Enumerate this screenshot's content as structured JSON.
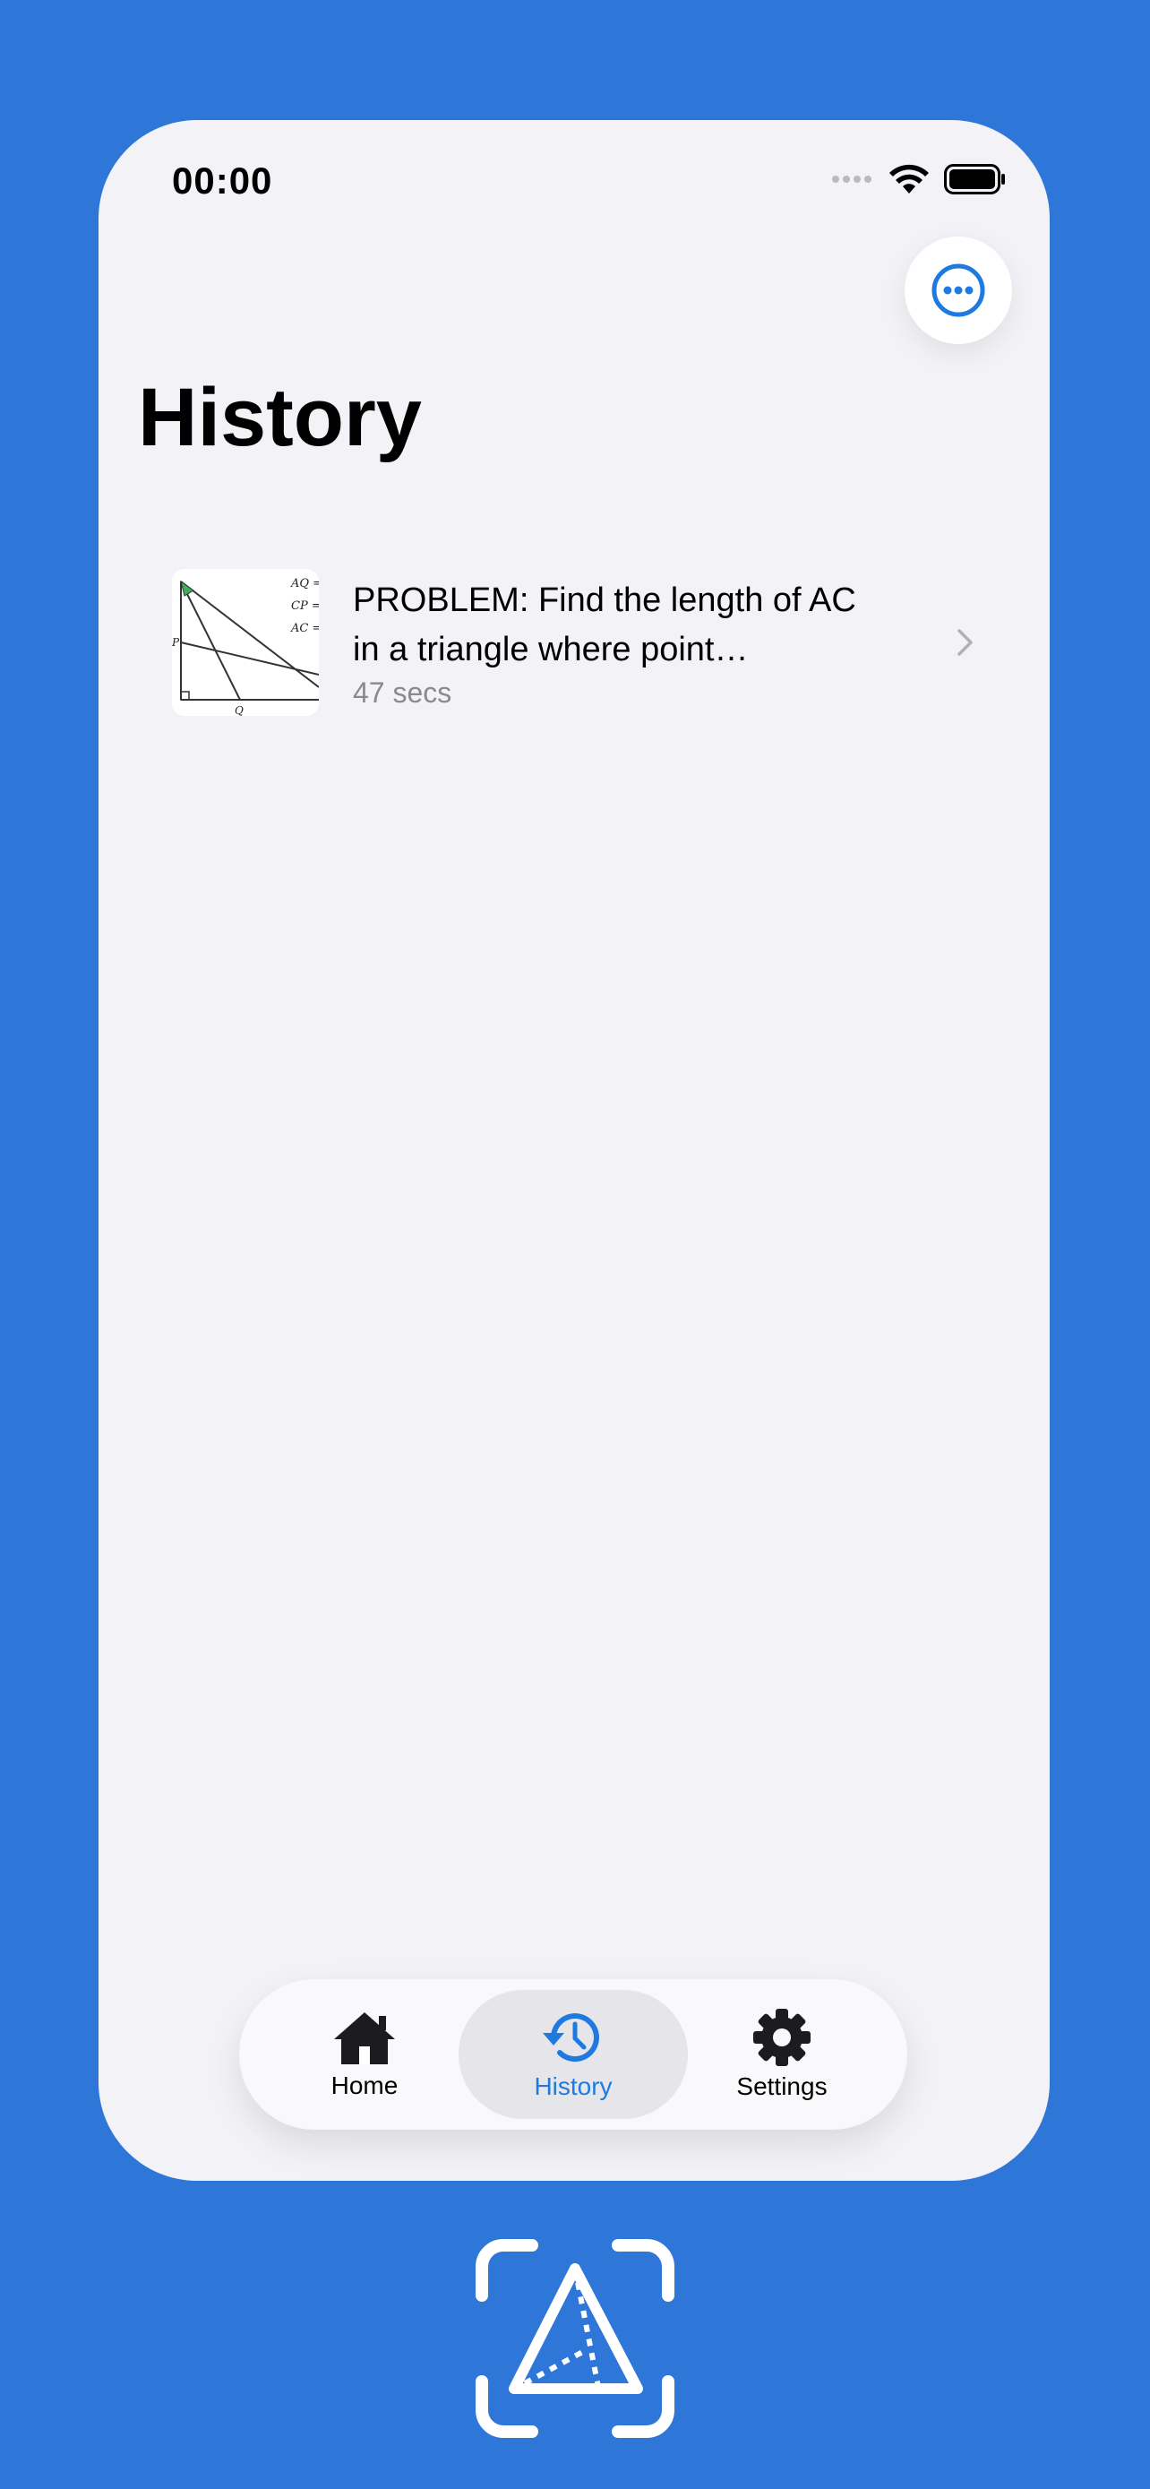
{
  "status_bar": {
    "time": "00:00"
  },
  "header": {
    "title": "History",
    "more_button_icon": "ellipsis-circle-icon"
  },
  "history": {
    "items": [
      {
        "title": "PROBLEM: Find the length of AC in a triangle where point…",
        "duration": "47 secs",
        "thumbnail_labels": [
          "AQ =",
          "CP =",
          "AC =",
          "P",
          "Q"
        ]
      }
    ]
  },
  "tab_bar": {
    "tabs": [
      {
        "label": "Home",
        "icon": "house-icon"
      },
      {
        "label": "History",
        "icon": "clock-history-icon"
      },
      {
        "label": "Settings",
        "icon": "gear-icon"
      }
    ],
    "active_tab": "History"
  },
  "colors": {
    "background": "#2e76d8",
    "accent": "#1f7ae0",
    "screen": "#f2f2f7"
  }
}
